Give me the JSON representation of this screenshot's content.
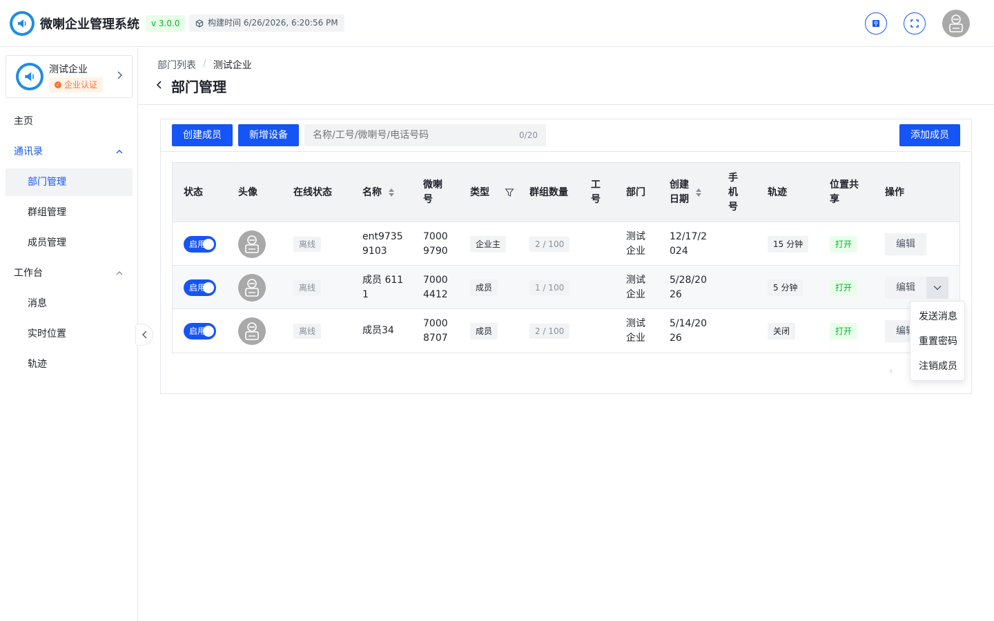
{
  "header": {
    "app_title": "微喇企业管理系统",
    "version": "v 3.0.0",
    "build_time": "构建时间 6/26/2026, 6:20:56 PM",
    "icons": [
      "megaphone-logo-icon",
      "build-cube-icon",
      "book-icon",
      "fullscreen-icon",
      "user-avatar-icon"
    ]
  },
  "sidebar": {
    "company_name": "测试企业",
    "cert_label": "企业认证",
    "items": [
      {
        "label": "主页"
      },
      {
        "label": "通讯录"
      },
      {
        "label": "部门管理"
      },
      {
        "label": "群组管理"
      },
      {
        "label": "成员管理"
      },
      {
        "label": "工作台"
      },
      {
        "label": "消息"
      },
      {
        "label": "实时位置"
      },
      {
        "label": "轨迹"
      }
    ]
  },
  "breadcrumb": {
    "items": [
      "部门列表",
      "测试企业"
    ],
    "separator": "/"
  },
  "page_title": "部门管理",
  "toolbar": {
    "create_member": "创建成员",
    "add_device": "新增设备",
    "search_placeholder": "名称/工号/微喇号/电话号码",
    "search_count": "0/20",
    "add_member": "添加成员"
  },
  "table": {
    "headers": {
      "status": "状态",
      "avatar": "头像",
      "online": "在线状态",
      "name": "名称",
      "weila_id": "微喇\n号",
      "type": "类型",
      "groups": "群组数量",
      "job_no": "工\n号",
      "dept": "部门",
      "created": "创建\n日期",
      "phone": "手\n机\n号",
      "track": "轨迹",
      "location_share": "位置共\n享",
      "actions": "操作"
    },
    "rows": [
      {
        "status": "启用",
        "online": "离线",
        "name": "ent9735\n9103",
        "weila_id": "7000\n9790",
        "type": "企业主",
        "groups": "2 / 100",
        "dept": "测试\n企业",
        "created": "12/17/2\n024",
        "track": "15 分钟",
        "location_share": "打开",
        "edit": "编辑"
      },
      {
        "status": "启用",
        "online": "离线",
        "name": "成员 611\n1",
        "weila_id": "7000\n4412",
        "type": "成员",
        "groups": "1 / 100",
        "dept": "测试\n企业",
        "created": "5/28/20\n26",
        "track": "5 分钟",
        "location_share": "打开",
        "edit": "编辑"
      },
      {
        "status": "启用",
        "online": "离线",
        "name": "成员34",
        "weila_id": "7000\n8707",
        "type": "成员",
        "groups": "2 / 100",
        "dept": "测试\n企业",
        "created": "5/14/20\n26",
        "track": "关闭",
        "location_share": "打开",
        "edit": "编辑"
      }
    ]
  },
  "dropdown": {
    "items": [
      "发送消息",
      "重置密码",
      "注销成员"
    ]
  },
  "colors": {
    "primary": "#1655f5",
    "success": "#00b42a",
    "warning": "#f77234",
    "border": "#e5e6eb"
  }
}
